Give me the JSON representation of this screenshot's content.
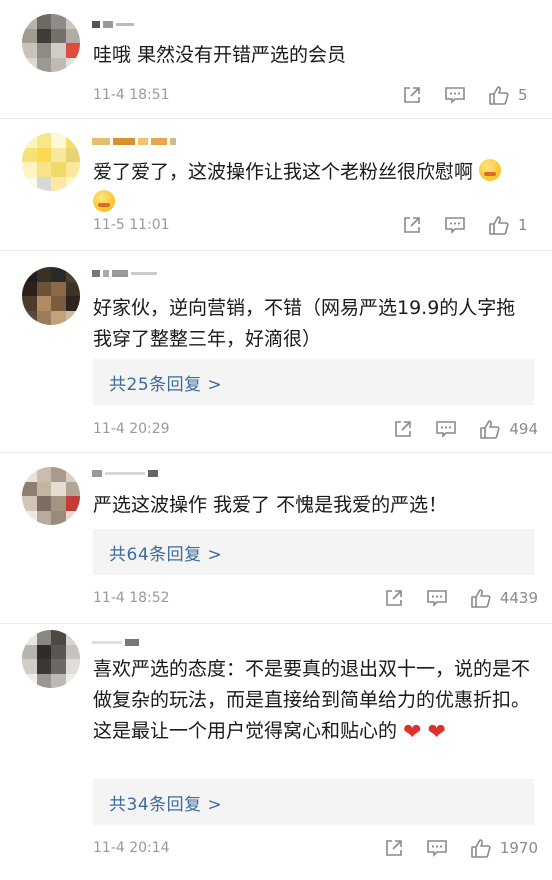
{
  "comments": [
    {
      "text": "哇哦 果然没有开错严选的会员",
      "time": "11-4 18:51",
      "likes": "5"
    },
    {
      "text": "爱了爱了，这波操作让我这个老粉丝很欣慰啊",
      "time": "11-5 11:01",
      "likes": "1"
    },
    {
      "text": "好家伙，逆向营销，不错（网易严选19.9的人字拖我穿了整整三年，好滴很）",
      "replies": "共25条回复 >",
      "time": "11-4 20:29",
      "likes": "494"
    },
    {
      "text": "严选这波操作 我爱了 不愧是我爱的严选！",
      "replies": "共64条回复 >",
      "time": "11-4 18:52",
      "likes": "4439"
    },
    {
      "text": "喜欢严选的态度：不是要真的退出双十一，说的是不做复杂的玩法，而是直接给到简单给力的优惠折扣。这是最让一个用户觉得窝心和贴心的",
      "replies": "共34条回复 >",
      "time": "11-4 20:14",
      "likes": "1970"
    }
  ],
  "icons": {
    "share": "share-icon",
    "comment": "comment-icon",
    "like": "thumbs-up-icon"
  },
  "colors": {
    "link": "#3d6a9e",
    "heart": "#e0302a",
    "meta": "#9a9a9a"
  }
}
